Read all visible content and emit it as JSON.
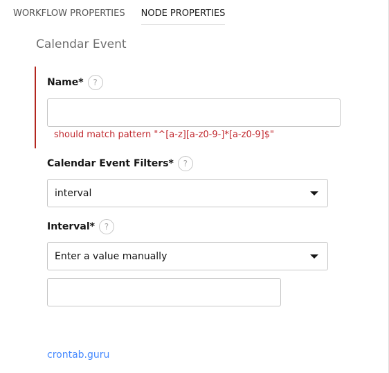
{
  "tabs": [
    {
      "label": "WORKFLOW PROPERTIES"
    },
    {
      "label": "NODE PROPERTIES"
    }
  ],
  "section_title": "Calendar Event",
  "fields": {
    "name": {
      "label": "Name*",
      "help": "?",
      "value": "",
      "error": "should match pattern \"^[a-z][a-z0-9-]*[a-z0-9]$\""
    },
    "filters": {
      "label": "Calendar Event Filters*",
      "help": "?",
      "selected": "interval"
    },
    "interval": {
      "label": "Interval*",
      "help": "?",
      "selected": "Enter a value manually",
      "value": ""
    }
  },
  "link": {
    "label": "crontab.guru"
  },
  "colors": {
    "error": "#c0272d",
    "link": "#4589ff",
    "border": "#c6c6c6"
  },
  "icons": {
    "help": "help-circle-icon",
    "dropdown": "caret-down-icon"
  }
}
